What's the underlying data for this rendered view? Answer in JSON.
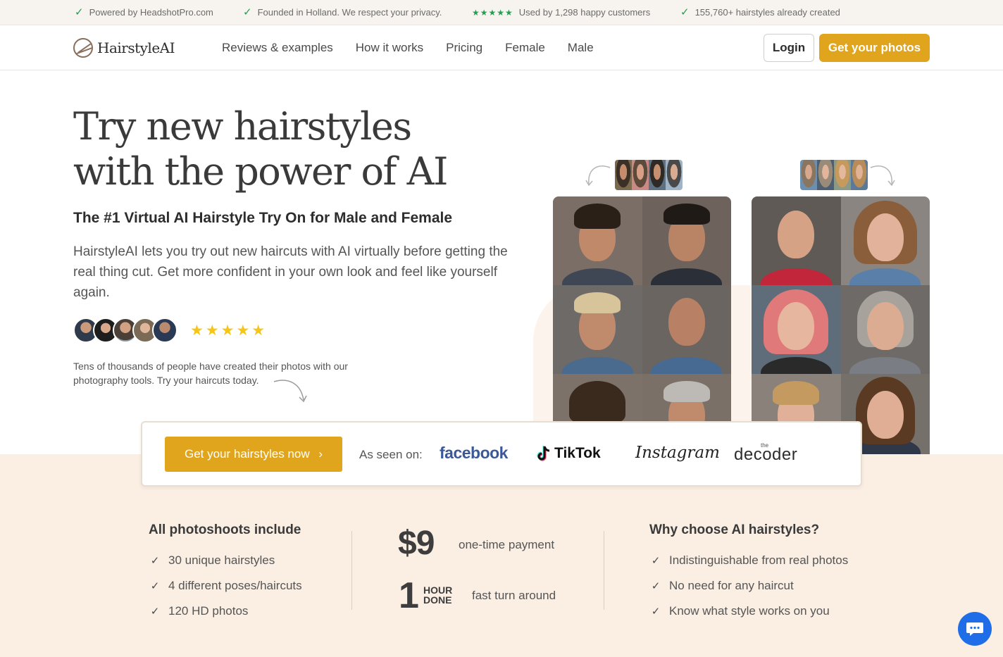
{
  "topbar": {
    "items": [
      "Powered by HeadshotPro.com",
      "Founded in Holland. We respect your privacy.",
      "Used by 1,298 happy customers",
      "155,760+ hairstyles already created"
    ],
    "rating_stars": "★★★★★"
  },
  "nav": {
    "logo_text": "HairstyleAI",
    "links": [
      "Reviews & examples",
      "How it works",
      "Pricing",
      "Female",
      "Male"
    ],
    "login_label": "Login",
    "cta_label": "Get your photos"
  },
  "hero": {
    "title_line1": "Try new hairstyles",
    "title_line2": "with the power of AI",
    "subtitle": "The #1 Virtual AI Hairstyle Try On for Male and Female",
    "description": "HairstyleAI lets you try out new haircuts with AI virtually before getting the real thing cut. Get more confident in your own look and feel like yourself again.",
    "stars": "★★★★★",
    "social_note": "Tens of thousands of people have created their photos with our photography tools. Try your haircuts today."
  },
  "cta_bar": {
    "button_label": "Get your hairstyles now",
    "button_chevron": "›",
    "seen_on_label": "As seen on:",
    "brands": {
      "facebook": "facebook",
      "tiktok": "TikTok",
      "instagram": "Instagram",
      "decoder": "decoder",
      "decoder_prefix": "the"
    }
  },
  "features": {
    "includes_title": "All photoshoots include",
    "includes": [
      "30 unique hairstyles",
      "4 different poses/haircuts",
      "120 HD photos"
    ],
    "price": "$9",
    "price_label": "one-time payment",
    "hour_number": "1",
    "hour_word1": "HOUR",
    "hour_word2": "DONE",
    "hour_label": "fast turn around",
    "why_title": "Why choose AI hairstyles?",
    "why": [
      "Indistinguishable from real photos",
      "No need for any haircut",
      "Know what style works on you"
    ]
  },
  "colors": {
    "accent": "#e0a51c",
    "beige": "#fbeee3",
    "green_check": "#22a052",
    "chat_blue": "#1f6ee8"
  }
}
